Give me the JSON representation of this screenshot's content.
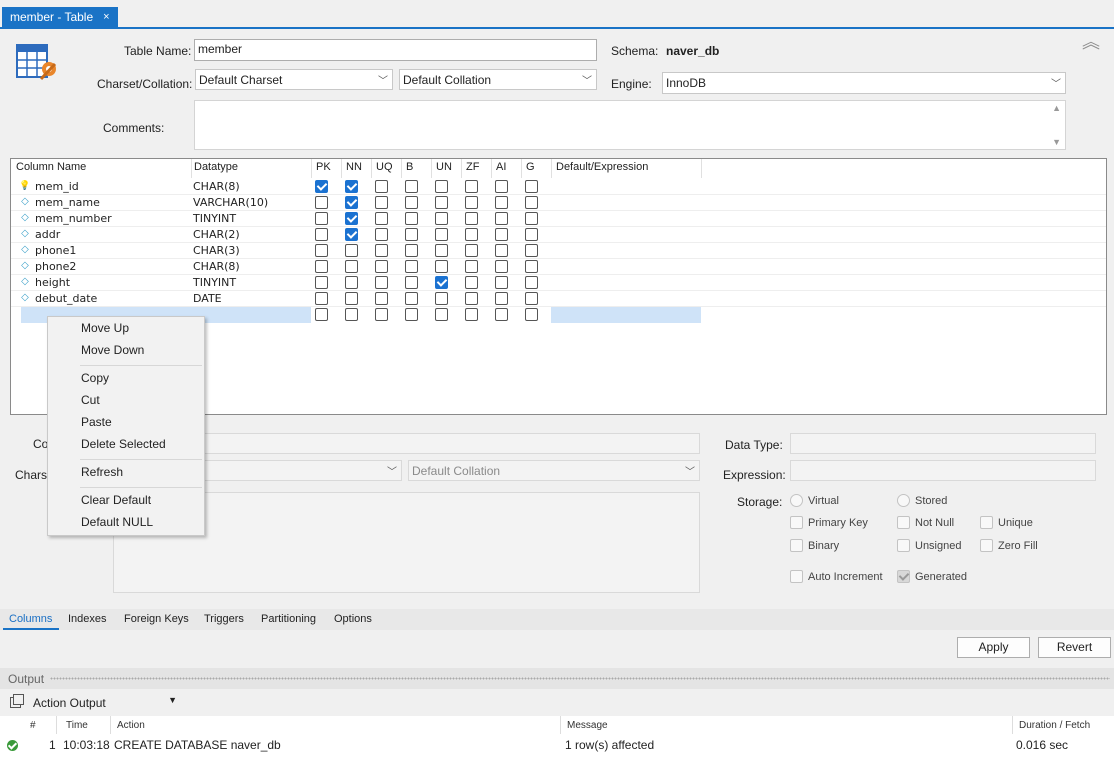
{
  "tab": {
    "title": "member - Table",
    "close": "×"
  },
  "form": {
    "table_name_label": "Table Name:",
    "table_name_value": "member",
    "schema_label": "Schema:",
    "schema_value": "naver_db",
    "charset_label": "Charset/Collation:",
    "charset_value": "Default Charset",
    "collation_value": "Default Collation",
    "engine_label": "Engine:",
    "engine_value": "InnoDB",
    "comments_label": "Comments:",
    "collapse_icon": "chevron-double-up-icon"
  },
  "grid": {
    "headers": [
      "Column Name",
      "Datatype",
      "PK",
      "NN",
      "UQ",
      "B",
      "UN",
      "ZF",
      "AI",
      "G",
      "Default/Expression"
    ],
    "rows": [
      {
        "icon": "key-icon",
        "name": "mem_id",
        "type": "CHAR(8)",
        "flags": [
          1,
          1,
          0,
          0,
          0,
          0,
          0,
          0
        ]
      },
      {
        "icon": "diamond-icon",
        "name": "mem_name",
        "type": "VARCHAR(10)",
        "flags": [
          0,
          1,
          0,
          0,
          0,
          0,
          0,
          0
        ]
      },
      {
        "icon": "diamond-icon",
        "name": "mem_number",
        "type": "TINYINT",
        "flags": [
          0,
          1,
          0,
          0,
          0,
          0,
          0,
          0
        ]
      },
      {
        "icon": "diamond-icon",
        "name": "addr",
        "type": "CHAR(2)",
        "flags": [
          0,
          1,
          0,
          0,
          0,
          0,
          0,
          0
        ]
      },
      {
        "icon": "diamond-icon",
        "name": "phone1",
        "type": "CHAR(3)",
        "flags": [
          0,
          0,
          0,
          0,
          0,
          0,
          0,
          0
        ]
      },
      {
        "icon": "diamond-icon",
        "name": "phone2",
        "type": "CHAR(8)",
        "flags": [
          0,
          0,
          0,
          0,
          0,
          0,
          0,
          0
        ]
      },
      {
        "icon": "diamond-icon",
        "name": "height",
        "type": "TINYINT",
        "flags": [
          0,
          0,
          0,
          0,
          1,
          0,
          0,
          0
        ]
      },
      {
        "icon": "diamond-icon",
        "name": "debut_date",
        "type": "DATE",
        "flags": [
          0,
          0,
          0,
          0,
          0,
          0,
          0,
          0
        ]
      }
    ]
  },
  "context_menu": {
    "items": [
      "Move Up",
      "Move Down",
      "Copy",
      "Cut",
      "Paste",
      "Delete Selected",
      "Refresh",
      "Clear Default",
      "Default NULL"
    ]
  },
  "details": {
    "col_label_partial": "Co",
    "charset_label_partial": "Charse",
    "collation_value": "Default Collation",
    "data_type_label": "Data Type:",
    "expression_label": "Expression:",
    "storage_label": "Storage:",
    "virtual": "Virtual",
    "stored": "Stored",
    "primary_key": "Primary Key",
    "not_null": "Not Null",
    "unique": "Unique",
    "binary": "Binary",
    "unsigned": "Unsigned",
    "zero_fill": "Zero Fill",
    "auto_increment": "Auto Increment",
    "generated": "Generated"
  },
  "subtabs": [
    "Columns",
    "Indexes",
    "Foreign Keys",
    "Triggers",
    "Partitioning",
    "Options"
  ],
  "buttons": {
    "apply": "Apply",
    "revert": "Revert"
  },
  "output": {
    "title": "Output",
    "selector": "Action Output",
    "headers": [
      "#",
      "Time",
      "Action",
      "Message",
      "Duration / Fetch"
    ],
    "row": {
      "num": "1",
      "time": "10:03:18",
      "action": "CREATE DATABASE naver_db",
      "message": "1 row(s) affected",
      "duration": "0.016 sec"
    }
  }
}
